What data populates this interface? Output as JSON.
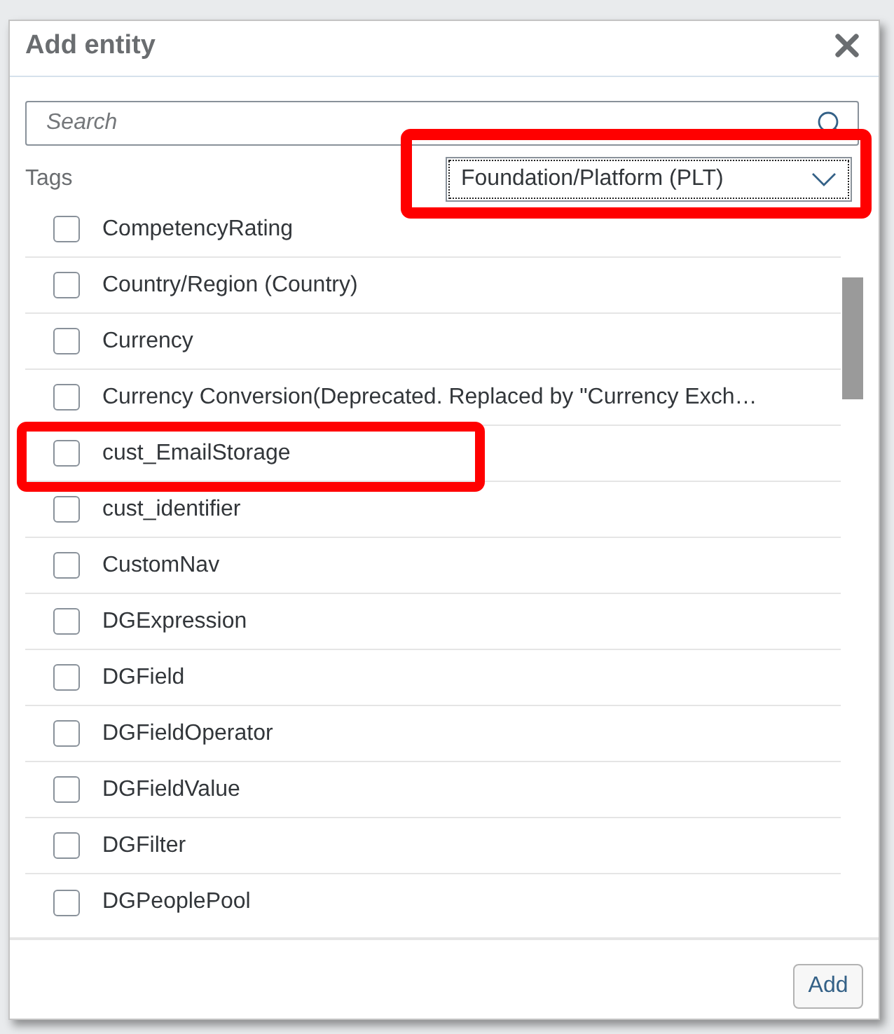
{
  "dialog": {
    "title": "Add entity"
  },
  "search": {
    "placeholder": "Search"
  },
  "tags": {
    "label": "Tags",
    "value": "Foundation/Platform (PLT)",
    "highlighted": true
  },
  "entities": [
    {
      "label": "CompetencyRating",
      "checked": false,
      "highlighted": false
    },
    {
      "label": "Country/Region (Country)",
      "checked": false,
      "highlighted": false
    },
    {
      "label": "Currency",
      "checked": false,
      "highlighted": false
    },
    {
      "label": "Currency Conversion(Deprecated. Replaced by \"Currency Exch…",
      "checked": false,
      "highlighted": false
    },
    {
      "label": "cust_EmailStorage",
      "checked": false,
      "highlighted": true
    },
    {
      "label": "cust_identifier",
      "checked": false,
      "highlighted": false
    },
    {
      "label": "CustomNav",
      "checked": false,
      "highlighted": false
    },
    {
      "label": "DGExpression",
      "checked": false,
      "highlighted": false
    },
    {
      "label": "DGField",
      "checked": false,
      "highlighted": false
    },
    {
      "label": "DGFieldOperator",
      "checked": false,
      "highlighted": false
    },
    {
      "label": "DGFieldValue",
      "checked": false,
      "highlighted": false
    },
    {
      "label": "DGFilter",
      "checked": false,
      "highlighted": false
    },
    {
      "label": "DGPeoplePool",
      "checked": false,
      "highlighted": false
    }
  ],
  "buttons": [
    {
      "label": "Add"
    }
  ]
}
